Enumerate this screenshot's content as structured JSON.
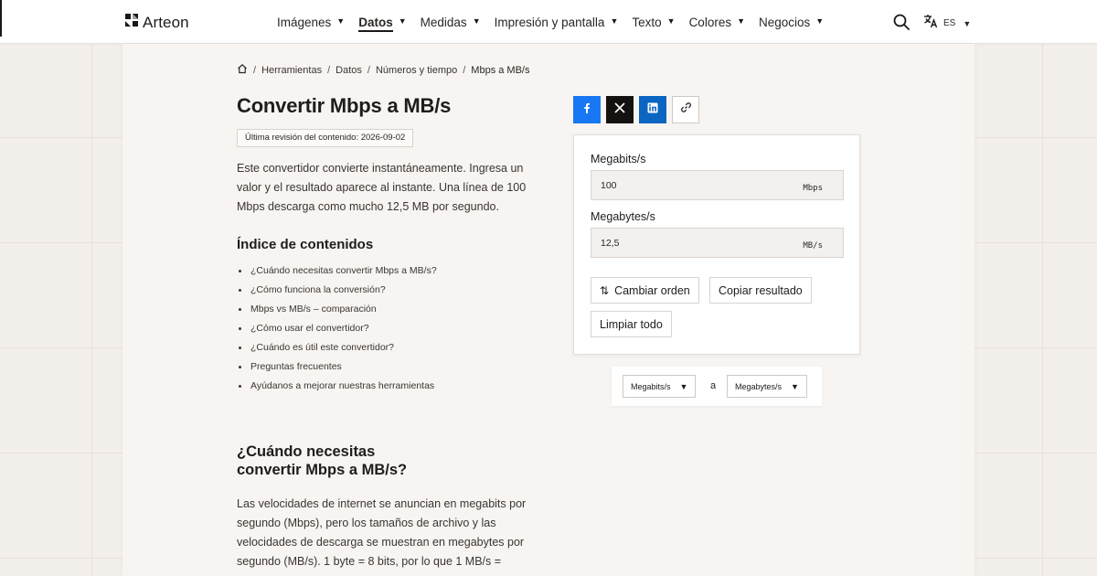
{
  "brand": {
    "name": "Arteon"
  },
  "nav": [
    {
      "label": "Imágenes"
    },
    {
      "label": "Datos"
    },
    {
      "label": "Medidas"
    },
    {
      "label": "Impresión y pantalla"
    },
    {
      "label": "Texto"
    },
    {
      "label": "Colores"
    },
    {
      "label": "Negocios"
    }
  ],
  "language": {
    "code": "ES"
  },
  "breadcrumb": [
    "Herramientas",
    "Datos",
    "Números y tiempo",
    "Mbps a MB/s"
  ],
  "page": {
    "title": "Convertir Mbps a MB/s",
    "revision": "Última revisión del contenido: 2026-09-02",
    "intro": "Este convertidor convierte instantáneamente. Ingresa un valor y el resultado aparece al instante. Una línea de 100 Mbps descarga como mucho 12,5 MB por segundo.",
    "toc_title": "Índice de contenidos",
    "toc": [
      "¿Cuándo necesitas convertir Mbps a MB/s?",
      "¿Cómo funciona la conversión?",
      "Mbps vs MB/s – comparación",
      "¿Cómo usar el convertidor?",
      "¿Cuándo es útil este convertidor?",
      "Preguntas frecuentes",
      "Ayúdanos a mejorar nuestras herramientas"
    ],
    "section_title_line1": "¿Cuándo necesitas",
    "section_title_line2": "convertir Mbps a MB/s?",
    "section_text": "Las velocidades de internet se anuncian en megabits por segundo (Mbps), pero los tamaños de archivo y las velocidades de descarga se muestran en megabytes por segundo (MB/s). 1 byte = 8 bits, por lo que 1 MB/s ="
  },
  "share": [
    "facebook-icon",
    "x-icon",
    "linkedin-icon",
    "link-icon"
  ],
  "converter": {
    "input_label": "Megabits/s",
    "input_value": "100",
    "input_unit": "Mbps",
    "output_label": "Megabytes/s",
    "output_value": "12,5",
    "output_unit": "MB/s",
    "swap_label": "Cambiar orden",
    "copy_label": "Copiar resultado",
    "clear_label": "Limpiar todo"
  },
  "unit_selector": {
    "from": "Megabits/s",
    "connector": "a",
    "to": "Megabytes/s"
  },
  "colors": {
    "facebook": "#1877f2",
    "x": "#131211",
    "linkedin": "#0a66c2",
    "page_bg": "#f3efeb",
    "panel_bg": "#f7f4f1"
  }
}
